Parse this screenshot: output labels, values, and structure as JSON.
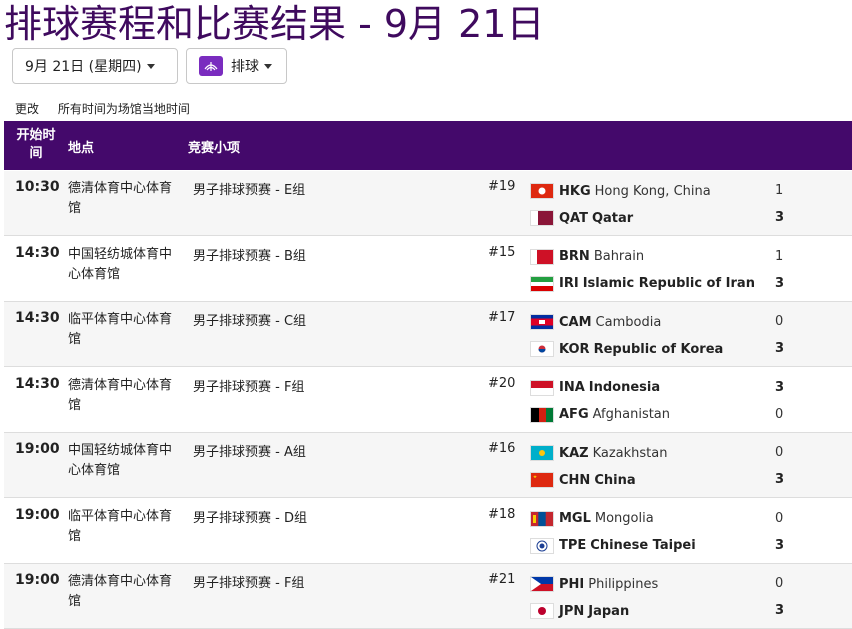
{
  "page": {
    "title": "排球赛程和比赛结果 - 9月 21日"
  },
  "filters": {
    "date_label": "9月 21日 (星期四)",
    "sport_label": "排球"
  },
  "links": {
    "more": "更改",
    "timezone_note": "所有时间为场馆当地时间"
  },
  "table": {
    "headers": {
      "time": "开始时间",
      "venue": "地点",
      "event": "竞赛小项"
    },
    "rows": [
      {
        "time": "10:30",
        "venue": "德清体育中心体育馆",
        "event": "男子排球预赛 - E组",
        "match_no": "#19",
        "team1": {
          "code": "HKG",
          "name": "Hong Kong, China",
          "score": "1",
          "win": false,
          "flag": "hkg"
        },
        "team2": {
          "code": "QAT",
          "name": "Qatar",
          "score": "3",
          "win": true,
          "flag": "qat"
        }
      },
      {
        "time": "14:30",
        "venue": "中国轻纺城体育中心体育馆",
        "event": "男子排球预赛 - B组",
        "match_no": "#15",
        "team1": {
          "code": "BRN",
          "name": "Bahrain",
          "score": "1",
          "win": false,
          "flag": "brn"
        },
        "team2": {
          "code": "IRI",
          "name": "Islamic Republic of Iran",
          "score": "3",
          "win": true,
          "flag": "iri"
        }
      },
      {
        "time": "14:30",
        "venue": "临平体育中心体育馆",
        "event": "男子排球预赛 - C组",
        "match_no": "#17",
        "team1": {
          "code": "CAM",
          "name": "Cambodia",
          "score": "0",
          "win": false,
          "flag": "cam"
        },
        "team2": {
          "code": "KOR",
          "name": "Republic of Korea",
          "score": "3",
          "win": true,
          "flag": "kor"
        }
      },
      {
        "time": "14:30",
        "venue": "德清体育中心体育馆",
        "event": "男子排球预赛 - F组",
        "match_no": "#20",
        "team1": {
          "code": "INA",
          "name": "Indonesia",
          "score": "3",
          "win": true,
          "flag": "ina"
        },
        "team2": {
          "code": "AFG",
          "name": "Afghanistan",
          "score": "0",
          "win": false,
          "flag": "afg"
        }
      },
      {
        "time": "19:00",
        "venue": "中国轻纺城体育中心体育馆",
        "event": "男子排球预赛 - A组",
        "match_no": "#16",
        "team1": {
          "code": "KAZ",
          "name": "Kazakhstan",
          "score": "0",
          "win": false,
          "flag": "kaz"
        },
        "team2": {
          "code": "CHN",
          "name": "China",
          "score": "3",
          "win": true,
          "flag": "chn"
        }
      },
      {
        "time": "19:00",
        "venue": "临平体育中心体育馆",
        "event": "男子排球预赛 - D组",
        "match_no": "#18",
        "team1": {
          "code": "MGL",
          "name": "Mongolia",
          "score": "0",
          "win": false,
          "flag": "mgl"
        },
        "team2": {
          "code": "TPE",
          "name": "Chinese Taipei",
          "score": "3",
          "win": true,
          "flag": "tpe"
        }
      },
      {
        "time": "19:00",
        "venue": "德清体育中心体育馆",
        "event": "男子排球预赛 - F组",
        "match_no": "#21",
        "team1": {
          "code": "PHI",
          "name": "Philippines",
          "score": "0",
          "win": false,
          "flag": "phi"
        },
        "team2": {
          "code": "JPN",
          "name": "Japan",
          "score": "3",
          "win": true,
          "flag": "jpn"
        }
      }
    ]
  },
  "colors": {
    "brand": "#44096b",
    "title": "#3f0a5e"
  }
}
